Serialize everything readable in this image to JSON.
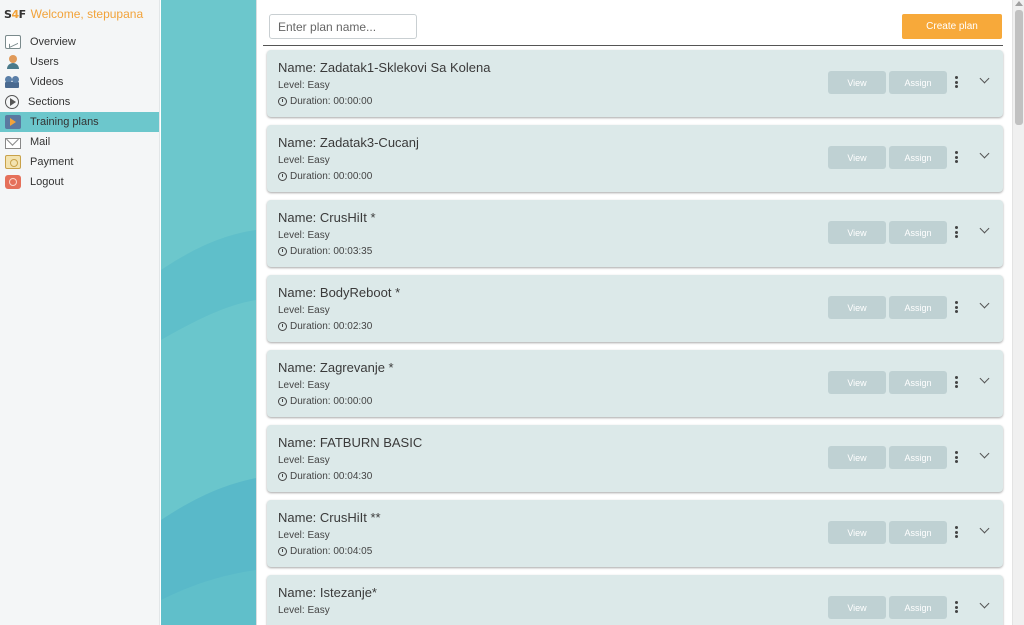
{
  "sidebar": {
    "logo": {
      "left": "S",
      "mid": "4",
      "right": "F"
    },
    "welcome": "Welcome, stepupana",
    "items": [
      {
        "label": "Overview",
        "icon": "overview-icon",
        "active": false
      },
      {
        "label": "Users",
        "icon": "users-icon",
        "active": false
      },
      {
        "label": "Videos",
        "icon": "videos-icon",
        "active": false
      },
      {
        "label": "Sections",
        "icon": "sections-icon",
        "active": false
      },
      {
        "label": "Training plans",
        "icon": "training-plans-icon",
        "active": true
      },
      {
        "label": "Mail",
        "icon": "mail-icon",
        "active": false
      },
      {
        "label": "Payment",
        "icon": "payment-icon",
        "active": false
      },
      {
        "label": "Logout",
        "icon": "logout-icon",
        "active": false
      }
    ]
  },
  "toolbar": {
    "search_placeholder": "Enter plan name...",
    "search_value": "",
    "create_label": "Create plan"
  },
  "plan_buttons": {
    "view": "View",
    "assign": "Assign"
  },
  "plans": [
    {
      "name": "Name: Zadatak1-Sklekovi Sa Kolena",
      "level": "Level: Easy",
      "duration": "Duration: 00:00:00"
    },
    {
      "name": "Name: Zadatak3-Cucanj",
      "level": "Level: Easy",
      "duration": "Duration: 00:00:00"
    },
    {
      "name": "Name: CrusHiIt *",
      "level": "Level: Easy",
      "duration": "Duration: 00:03:35"
    },
    {
      "name": "Name: BodyReboot *",
      "level": "Level: Easy",
      "duration": "Duration: 00:02:30"
    },
    {
      "name": "Name: Zagrevanje *",
      "level": "Level: Easy",
      "duration": "Duration: 00:00:00"
    },
    {
      "name": "Name: FATBURN BASIC",
      "level": "Level: Easy",
      "duration": "Duration: 00:04:30"
    },
    {
      "name": "Name: CrusHiIt **",
      "level": "Level: Easy",
      "duration": "Duration: 00:04:05"
    },
    {
      "name": "Name: Istezanje*",
      "level": "Level: Easy",
      "duration": ""
    }
  ],
  "colors": {
    "accent_orange": "#f7a93a",
    "sidebar_active": "#6cc7cc",
    "card_bg": "#dce9e9",
    "button_disabled": "#bfd1d3"
  }
}
